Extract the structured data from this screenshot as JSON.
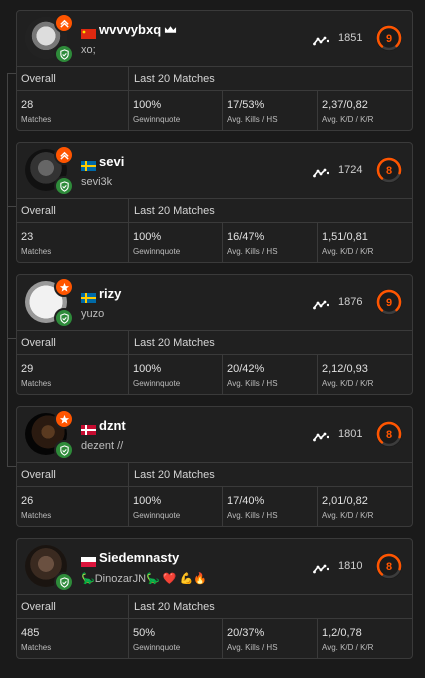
{
  "labels": {
    "overall": "Overall",
    "last20": "Last 20 Matches",
    "matches": "Matches",
    "winrate": "Gewinnquote",
    "kills_hs": "Avg. Kills / HS",
    "kd_kr": "Avg. K/D / K/R"
  },
  "players": [
    {
      "name": "wvvvybxq",
      "flag": "china",
      "subtitle": "xo;",
      "elo": "1851",
      "level": "9",
      "level_color": "#ff5500",
      "crown": true,
      "badge": "chevrons-up-icon",
      "matches": "28",
      "winrate": "100%",
      "kills_hs": "17/53%",
      "kd_kr": "2,37/0,82"
    },
    {
      "name": "sevi",
      "flag": "sweden",
      "subtitle": "sevi3k",
      "elo": "1724",
      "level": "8",
      "level_color": "#ff5500",
      "crown": false,
      "badge": "chevrons-up-icon",
      "matches": "23",
      "winrate": "100%",
      "kills_hs": "16/47%",
      "kd_kr": "1,51/0,81"
    },
    {
      "name": "rizy",
      "flag": "sweden",
      "subtitle": "yuzo",
      "elo": "1876",
      "level": "9",
      "level_color": "#ff5500",
      "crown": false,
      "badge": "star-icon",
      "matches": "29",
      "winrate": "100%",
      "kills_hs": "20/42%",
      "kd_kr": "2,12/0,93"
    },
    {
      "name": "dznt",
      "flag": "denmark",
      "subtitle": "dezent //",
      "elo": "1801",
      "level": "8",
      "level_color": "#ff5500",
      "crown": false,
      "badge": "star-icon",
      "matches": "26",
      "winrate": "100%",
      "kills_hs": "17/40%",
      "kd_kr": "2,01/0,82"
    },
    {
      "name": "Siedemnasty",
      "flag": "poland",
      "subtitle": "🦕DinozarJN🦕 ❤️ 💪🔥",
      "elo": "1810",
      "level": "8",
      "level_color": "#ff5500",
      "crown": false,
      "badge": "",
      "matches": "485",
      "winrate": "50%",
      "kills_hs": "20/37%",
      "kd_kr": "1,2/0,78"
    }
  ]
}
